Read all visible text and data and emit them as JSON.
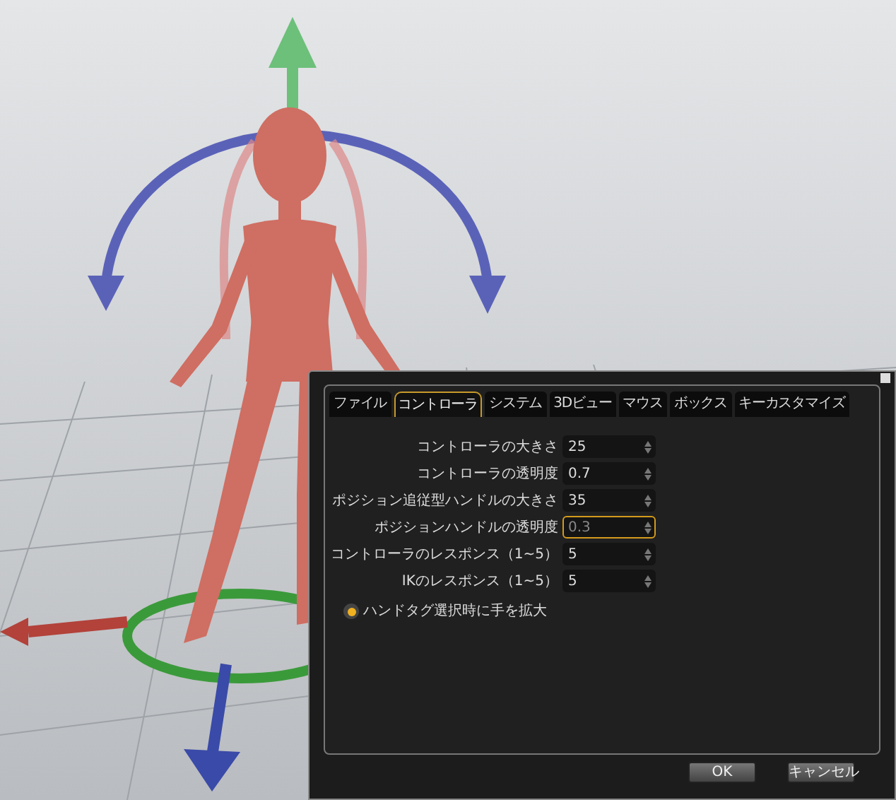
{
  "dialog": {
    "tabs": [
      {
        "label": "ファイル",
        "selected": false
      },
      {
        "label": "コントローラ",
        "selected": true
      },
      {
        "label": "システム",
        "selected": false
      },
      {
        "label": "3Dビュー",
        "selected": false
      },
      {
        "label": "マウス",
        "selected": false
      },
      {
        "label": "ボックス",
        "selected": false
      },
      {
        "label": "キーカスタマイズ",
        "selected": false
      }
    ],
    "settings": [
      {
        "label": "コントローラの大きさ",
        "value": "25",
        "focused": false
      },
      {
        "label": "コントローラの透明度",
        "value": "0.7",
        "focused": false
      },
      {
        "label": "ポジション追従型ハンドルの大きさ",
        "value": "35",
        "focused": false
      },
      {
        "label": "ポジションハンドルの透明度",
        "value": "0.3",
        "focused": true
      },
      {
        "label": "コントローラのレスポンス（1~5）",
        "value": "5",
        "focused": false
      },
      {
        "label": "IKのレスポンス（1~5）",
        "value": "5",
        "focused": false
      }
    ],
    "option": {
      "label": "ハンドタグ選択時に手を拡大",
      "checked": true
    },
    "buttons": [
      "OK",
      "キャンセル"
    ]
  }
}
